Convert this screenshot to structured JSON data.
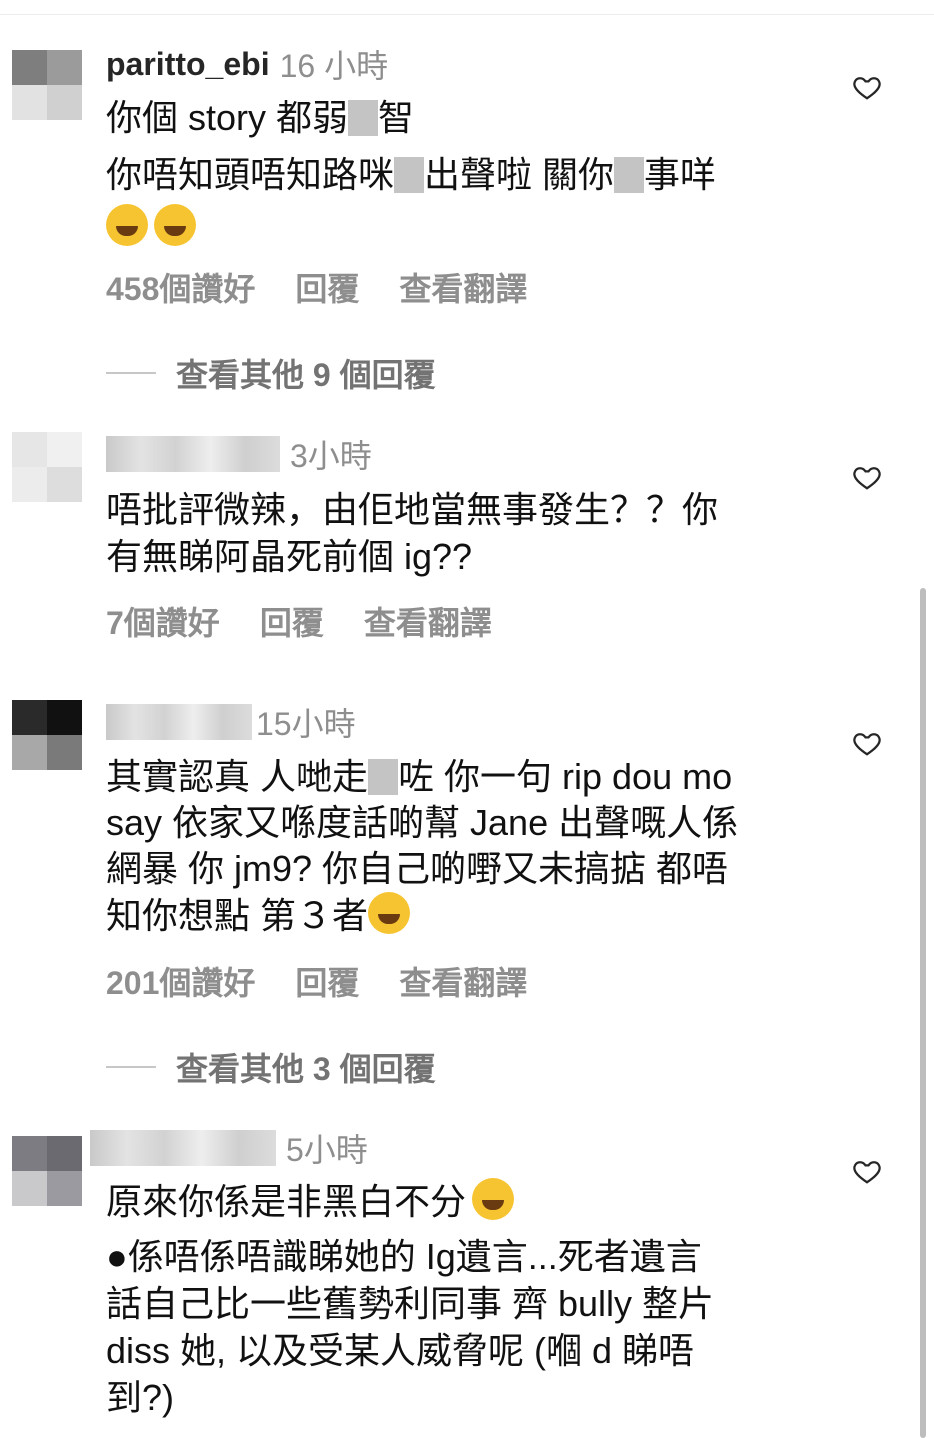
{
  "comments": [
    {
      "username": "paritto_ebi",
      "time": "16 小時",
      "lines": [
        "你個 story 都弱",
        "智",
        "你唔知頭唔知路咪",
        "出聲啦 關你",
        "事咩"
      ],
      "likes": "458個讚好",
      "reply": "回覆",
      "translate": "查看翻譯",
      "view_more": "查看其他 9 個回覆"
    },
    {
      "username": "",
      "time": "3小時",
      "lines": [
        "唔批評微辣，由佢地當無事發生？？你",
        "有無睇阿晶死前個 ig??"
      ],
      "likes": "7個讚好",
      "reply": "回覆",
      "translate": "查看翻譯"
    },
    {
      "username": "",
      "time": "15小時",
      "lines": [
        "其實認真 人哋走",
        "咗 你一句 rip dou mo",
        "say 依家又喺度話啲幫 Jane 出聲嘅人係",
        "網暴 你 jm9? 你自己啲嘢又未搞掂 都唔",
        "知你想點 第３者"
      ],
      "likes": "201個讚好",
      "reply": "回覆",
      "translate": "查看翻譯",
      "view_more": "查看其他 3 個回覆"
    },
    {
      "username": "",
      "time": "5小時",
      "lines": [
        "原來你係是非黑白不分",
        "●係唔係唔識睇她的 Ig遺言...死者遺言",
        "話自己比一些舊勢利同事 齊 bully 整片",
        "diss 她, 以及受某人威脅呢 (嗰 d 睇唔",
        "到?)"
      ]
    }
  ],
  "icons": {
    "like": "heart-outline-icon",
    "emoji_laugh": "tears-of-joy-emoji",
    "emoji_cry": "loudly-crying-emoji",
    "emoji_point": "backhand-index-pointing-left-emoji"
  },
  "colors": {
    "meta": "#8e8e8e",
    "text": "#111111",
    "username": "#262626"
  }
}
